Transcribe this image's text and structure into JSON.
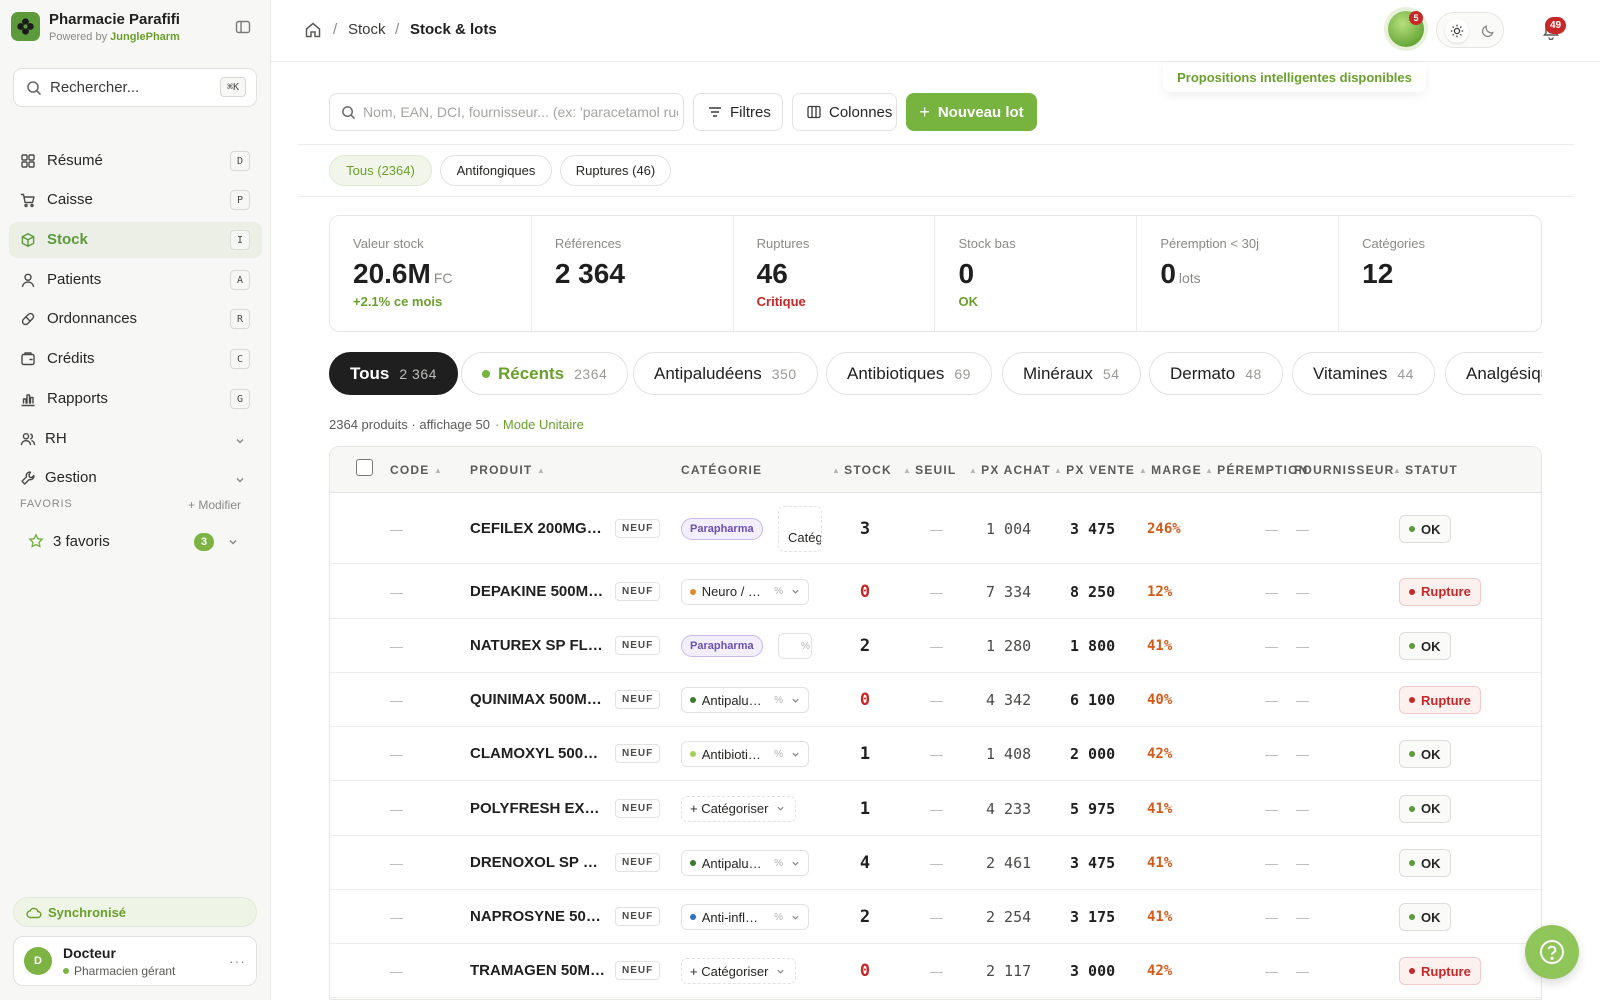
{
  "brand": {
    "name": "Pharmacie Parafifi",
    "powered_prefix": "Powered by",
    "powered_by": "JunglePharm"
  },
  "search": {
    "placeholder": "Rechercher...",
    "shortcut": "⌘K"
  },
  "nav": [
    {
      "label": "Résumé",
      "key": "D",
      "icon": "grid-icon"
    },
    {
      "label": "Caisse",
      "key": "P",
      "icon": "cart-icon"
    },
    {
      "label": "Stock",
      "key": "I",
      "icon": "box-icon",
      "active": true
    },
    {
      "label": "Patients",
      "key": "A",
      "icon": "user-icon"
    },
    {
      "label": "Ordonnances",
      "key": "R",
      "icon": "pill-icon"
    },
    {
      "label": "Crédits",
      "key": "C",
      "icon": "wallet-icon"
    },
    {
      "label": "Rapports",
      "key": "G",
      "icon": "bar-chart-icon"
    },
    {
      "label": "RH",
      "icon": "people-icon",
      "expandable": true
    },
    {
      "label": "Gestion",
      "icon": "wrench-icon",
      "expandable": true
    }
  ],
  "favorites": {
    "title": "FAVORIS",
    "edit": "+ Modifier",
    "item_label": "3 favoris",
    "count": "3"
  },
  "sync": {
    "label": "Synchronisé"
  },
  "user": {
    "initial": "D",
    "name": "Docteur",
    "role": "Pharmacien gérant",
    "more": "···"
  },
  "breadcrumb": {
    "sep": "/",
    "items": [
      "Stock",
      "Stock & lots"
    ]
  },
  "topbar": {
    "ai_count": "5",
    "notif_count": "49",
    "ai_hint": "Propositions intelligentes disponibles"
  },
  "toolbar": {
    "search_placeholder": "Nom, EAN, DCI, fournisseur... (ex: 'paracetamol rue",
    "filters": "Filtres",
    "columns": "Colonnes",
    "new_lot": "Nouveau lot"
  },
  "quick_filters": [
    "Tous (2364)",
    "Antifongiques",
    "Ruptures (46)"
  ],
  "stats": [
    {
      "label": "Valeur stock",
      "value": "20.6M",
      "unit": "FC",
      "note": "+2.1% ce mois",
      "note_color": "#6a9f2c"
    },
    {
      "label": "Références",
      "value": "2 364",
      "unit": "",
      "note": "",
      "note_color": "#6a9f2c"
    },
    {
      "label": "Ruptures",
      "value": "46",
      "unit": "",
      "note": "Critique",
      "note_color": "#c62828"
    },
    {
      "label": "Stock bas",
      "value": "0",
      "unit": "",
      "note": "OK",
      "note_color": "#6a9f2c"
    },
    {
      "label": "Péremption < 30j",
      "value": "0",
      "unit": "lots",
      "note": "",
      "note_color": "#6a9f2c"
    },
    {
      "label": "Catégories",
      "value": "12",
      "unit": "",
      "note": "",
      "note_color": "#6a9f2c"
    }
  ],
  "categories": [
    {
      "label": "Tous",
      "count": "2 364"
    },
    {
      "label": "Récents",
      "count": "2364"
    },
    {
      "label": "Antipaludéens",
      "count": "350"
    },
    {
      "label": "Antibiotiques",
      "count": "69"
    },
    {
      "label": "Minéraux",
      "count": "54"
    },
    {
      "label": "Dermato",
      "count": "48"
    },
    {
      "label": "Vitamines",
      "count": "44"
    },
    {
      "label": "Analgésiques",
      "count": ""
    }
  ],
  "summary": {
    "text": "2364 produits · affichage 50",
    "mode": "· Mode Unitaire"
  },
  "table": {
    "headers": {
      "code": "CODE",
      "product": "PRODUIT",
      "category": "CATÉGORIE",
      "stock": "STOCK",
      "threshold": "SEUIL",
      "buy": "PX ACHAT",
      "sell": "PX VENTE",
      "margin": "MARGE",
      "expiry": "PÉREMPTION",
      "supplier": "FOURNISSEUR",
      "status": "STATUT"
    },
    "dash": "—",
    "neuf": "NEUF",
    "uncategorized": "+ Catégoriser",
    "rows": [
      {
        "name": "CEFILEX 200MG …",
        "cat_type": "para",
        "cat": "Parapharma",
        "extra": "Catég",
        "stock": "3",
        "buy": "1 004",
        "sell": "3 475",
        "margin": "246%",
        "status": "OK"
      },
      {
        "name": "DEPAKINE 500M…",
        "cat_type": "dot",
        "cat": "Neuro / …",
        "dot": "#e08a2a",
        "stock": "0",
        "buy": "7 334",
        "sell": "8 250",
        "margin": "12%",
        "status": "Rupture"
      },
      {
        "name": "NATUREX SP FL/…",
        "cat_type": "para",
        "cat": "Parapharma",
        "extra": "",
        "stock": "2",
        "buy": "1 280",
        "sell": "1 800",
        "margin": "41%",
        "status": "OK"
      },
      {
        "name": "QUINIMAX 500M…",
        "cat_type": "dot",
        "cat": "Antipalu…",
        "dot": "#3a7d2c",
        "stock": "0",
        "buy": "4 342",
        "sell": "6 100",
        "margin": "40%",
        "status": "Rupture"
      },
      {
        "name": "CLAMOXYL 500…",
        "cat_type": "dot",
        "cat": "Antibioti…",
        "dot": "#a7cf5b",
        "stock": "1",
        "buy": "1 408",
        "sell": "2 000",
        "margin": "42%",
        "status": "OK"
      },
      {
        "name": "POLYFRESH EXT…",
        "cat_type": "none",
        "stock": "1",
        "buy": "4 233",
        "sell": "5 975",
        "margin": "41%",
        "status": "OK"
      },
      {
        "name": "DRENOXOL SP 3…",
        "cat_type": "dot",
        "cat": "Antipalu…",
        "dot": "#3a7d2c",
        "stock": "4",
        "buy": "2 461",
        "sell": "3 475",
        "margin": "41%",
        "status": "OK"
      },
      {
        "name": "NAPROSYNE 50…",
        "cat_type": "dot",
        "cat": "Anti-infl…",
        "dot": "#2f6fc4",
        "stock": "2",
        "buy": "2 254",
        "sell": "3 175",
        "margin": "41%",
        "status": "OK"
      },
      {
        "name": "TRAMAGEN 50M…",
        "cat_type": "none",
        "stock": "0",
        "buy": "2 117",
        "sell": "3 000",
        "margin": "42%",
        "status": "Rupture"
      }
    ]
  },
  "colors": {
    "accent": "#76b33f",
    "danger": "#c62828",
    "ok": "#6a9f2c",
    "margin": "#d45a1a"
  }
}
